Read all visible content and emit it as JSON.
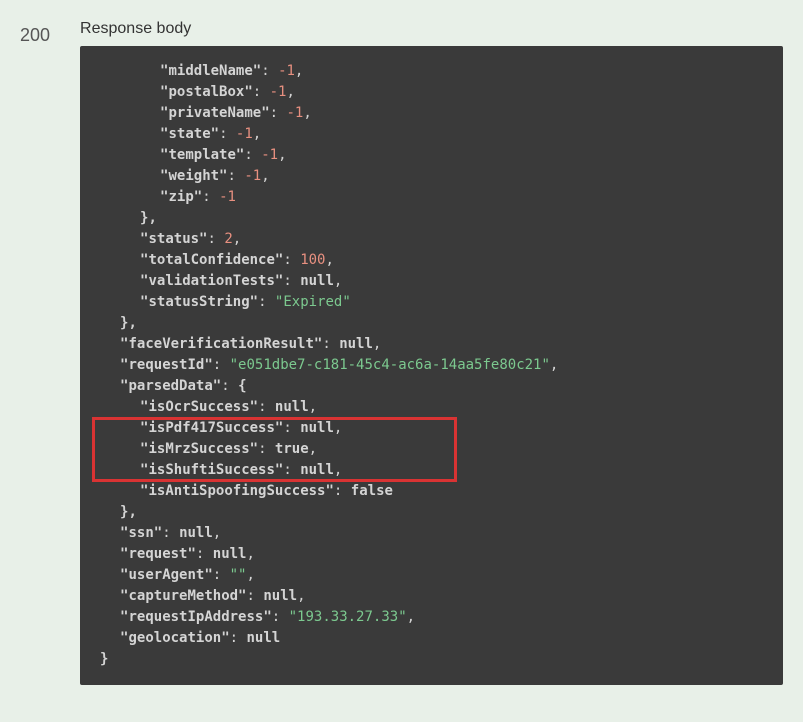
{
  "status_code": "200",
  "response_label": "Response body",
  "json": {
    "line1_key": "\"middleName\"",
    "line1_val": "-1",
    "line2_key": "\"postalBox\"",
    "line2_val": "-1",
    "line3_key": "\"privateName\"",
    "line3_val": "-1",
    "line4_key": "\"state\"",
    "line4_val": "-1",
    "line5_key": "\"template\"",
    "line5_val": "-1",
    "line6_key": "\"weight\"",
    "line6_val": "-1",
    "line7_key": "\"zip\"",
    "line7_val": "-1",
    "line8_brace": "},",
    "line9_key": "\"status\"",
    "line9_val": "2",
    "line10_key": "\"totalConfidence\"",
    "line10_val": "100",
    "line11_key": "\"validationTests\"",
    "line11_val": "null",
    "line12_key": "\"statusString\"",
    "line12_val": "\"Expired\"",
    "line13_brace": "},",
    "line14_key": "\"faceVerificationResult\"",
    "line14_val": "null",
    "line15_key": "\"requestId\"",
    "line15_val": "\"e051dbe7-c181-45c4-ac6a-14aa5fe80c21\"",
    "line16_key": "\"parsedData\"",
    "line16_val": "{",
    "line17_key": "\"isOcrSuccess\"",
    "line17_val": "null",
    "line18_key": "\"isPdf417Success\"",
    "line18_val": "null",
    "line19_key": "\"isMrzSuccess\"",
    "line19_val": "true",
    "line20_key": "\"isShuftiSuccess\"",
    "line20_val": "null",
    "line21_key": "\"isAntiSpoofingSuccess\"",
    "line21_val": "false",
    "line22_brace": "},",
    "line23_key": "\"ssn\"",
    "line23_val": "null",
    "line24_key": "\"request\"",
    "line24_val": "null",
    "line25_key": "\"userAgent\"",
    "line25_val": "\"\"",
    "line26_key": "\"captureMethod\"",
    "line26_val": "null",
    "line27_key": "\"requestIpAddress\"",
    "line27_val": "\"193.33.27.33\"",
    "line28_key": "\"geolocation\"",
    "line28_val": "null",
    "line29_brace": "}"
  },
  "highlight": {
    "top": "430",
    "left": "12",
    "width": "365",
    "height": "52"
  }
}
